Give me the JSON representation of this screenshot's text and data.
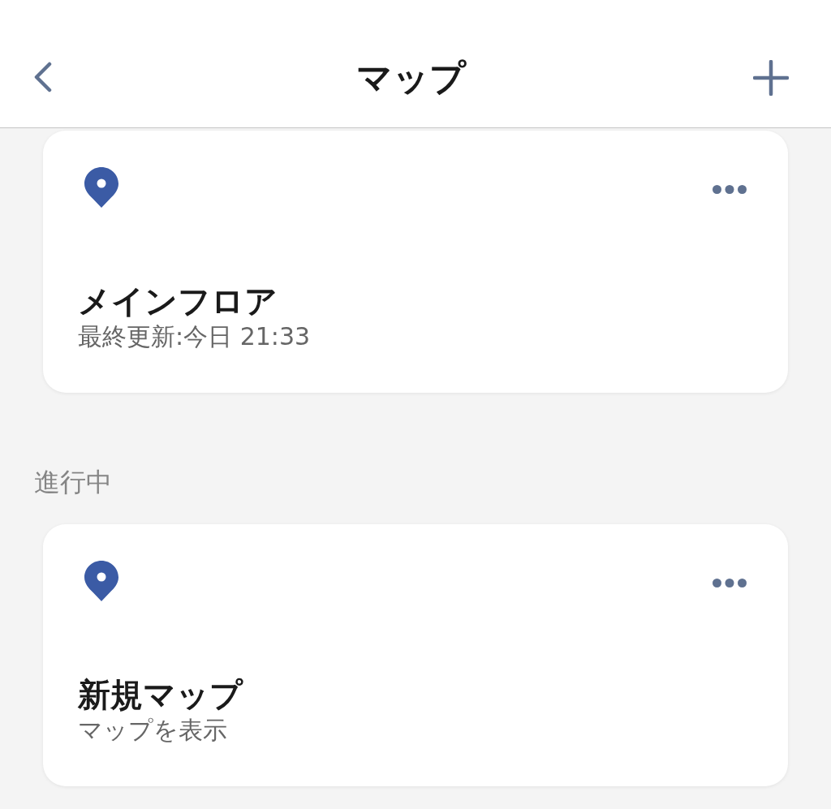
{
  "header": {
    "title": "マップ"
  },
  "sections": [
    {
      "maps": [
        {
          "title": "メインフロア",
          "subtitle": "最終更新:今日 21:33"
        }
      ]
    },
    {
      "heading": "進行中",
      "maps": [
        {
          "title": "新規マップ",
          "subtitle": "マップを表示"
        }
      ]
    }
  ]
}
